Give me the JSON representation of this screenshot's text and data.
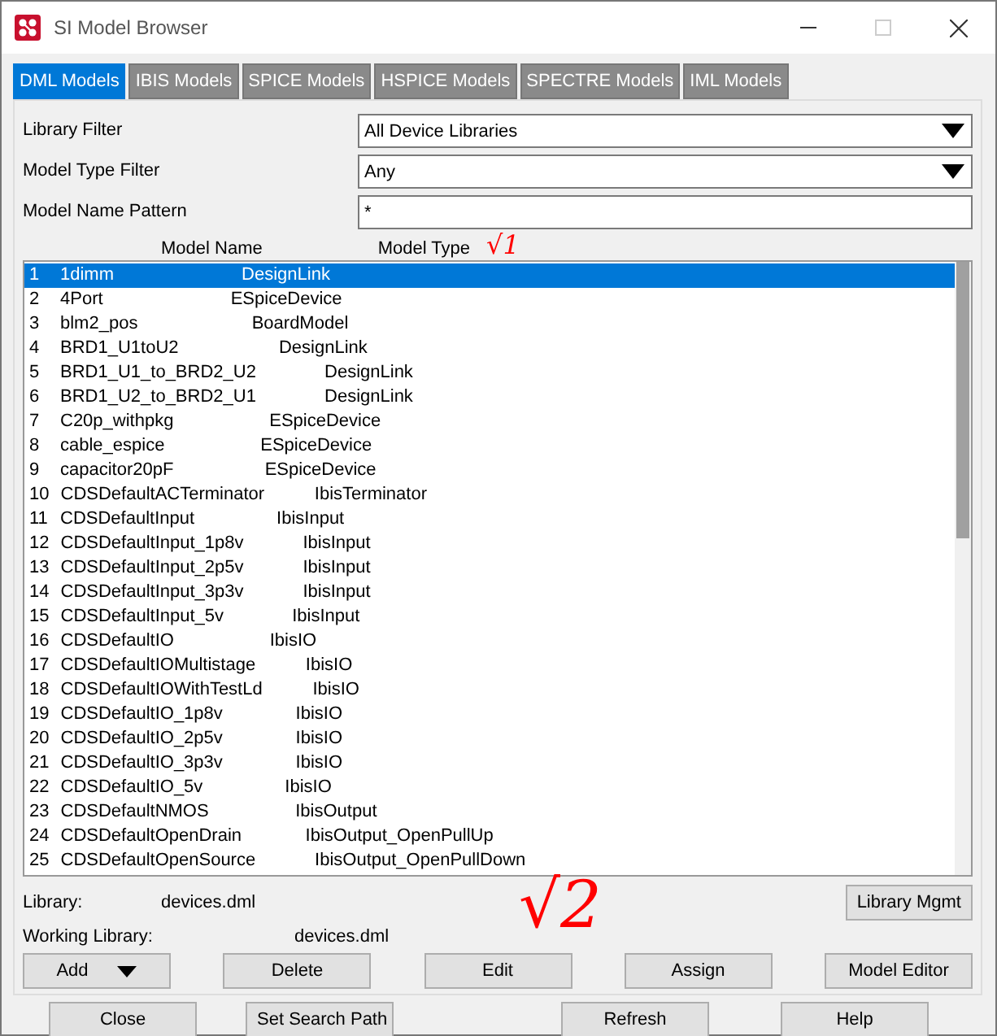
{
  "window": {
    "title": "SI Model Browser"
  },
  "tabs": [
    {
      "label": "DML Models",
      "selected": true
    },
    {
      "label": "IBIS Models",
      "selected": false
    },
    {
      "label": "SPICE Models",
      "selected": false
    },
    {
      "label": "HSPICE Models",
      "selected": false
    },
    {
      "label": "SPECTRE Models",
      "selected": false
    },
    {
      "label": "IML Models",
      "selected": false
    }
  ],
  "filters": [
    {
      "label": "Library Filter",
      "kind": "dropdown",
      "value": "All Device Libraries"
    },
    {
      "label": "Model Type Filter",
      "kind": "dropdown",
      "value": "Any"
    },
    {
      "label": "Model Name Pattern",
      "kind": "text",
      "value": "*"
    }
  ],
  "table": {
    "columns": [
      "Model Name",
      "Model Type"
    ],
    "rows": [
      {
        "number": "1",
        "name": "1dimm",
        "type": "DesignLink",
        "selected": true
      },
      {
        "number": "2",
        "name": "4Port",
        "type": "ESpiceDevice",
        "selected": false
      },
      {
        "number": "3",
        "name": "blm2_pos",
        "type": "BoardModel",
        "selected": false
      },
      {
        "number": "4",
        "name": "BRD1_U1toU2",
        "type": "DesignLink",
        "selected": false
      },
      {
        "number": "5",
        "name": "BRD1_U1_to_BRD2_U2",
        "type": "DesignLink",
        "selected": false
      },
      {
        "number": "6",
        "name": "BRD1_U2_to_BRD2_U1",
        "type": "DesignLink",
        "selected": false
      },
      {
        "number": "7",
        "name": "C20p_withpkg",
        "type": "ESpiceDevice",
        "selected": false
      },
      {
        "number": "8",
        "name": "cable_espice",
        "type": "ESpiceDevice",
        "selected": false
      },
      {
        "number": "9",
        "name": "capacitor20pF",
        "type": "ESpiceDevice",
        "selected": false
      },
      {
        "number": "10",
        "name": "CDSDefaultACTerminator",
        "type": "IbisTerminator",
        "selected": false
      },
      {
        "number": "11",
        "name": "CDSDefaultInput",
        "type": "IbisInput",
        "selected": false
      },
      {
        "number": "12",
        "name": "CDSDefaultInput_1p8v",
        "type": "IbisInput",
        "selected": false
      },
      {
        "number": "13",
        "name": "CDSDefaultInput_2p5v",
        "type": "IbisInput",
        "selected": false
      },
      {
        "number": "14",
        "name": "CDSDefaultInput_3p3v",
        "type": "IbisInput",
        "selected": false
      },
      {
        "number": "15",
        "name": "CDSDefaultInput_5v",
        "type": "IbisInput",
        "selected": false
      },
      {
        "number": "16",
        "name": "CDSDefaultIO",
        "type": "IbisIO",
        "selected": false
      },
      {
        "number": "17",
        "name": "CDSDefaultIOMultistage",
        "type": "IbisIO",
        "selected": false
      },
      {
        "number": "18",
        "name": "CDSDefaultIOWithTestLd",
        "type": "IbisIO",
        "selected": false
      },
      {
        "number": "19",
        "name": "CDSDefaultIO_1p8v",
        "type": "IbisIO",
        "selected": false
      },
      {
        "number": "20",
        "name": "CDSDefaultIO_2p5v",
        "type": "IbisIO",
        "selected": false
      },
      {
        "number": "21",
        "name": "CDSDefaultIO_3p3v",
        "type": "IbisIO",
        "selected": false
      },
      {
        "number": "22",
        "name": "CDSDefaultIO_5v",
        "type": "IbisIO",
        "selected": false
      },
      {
        "number": "23",
        "name": "CDSDefaultNMOS",
        "type": "IbisOutput",
        "selected": false
      },
      {
        "number": "24",
        "name": "CDSDefaultOpenDrain",
        "type": "IbisOutput_OpenPullUp",
        "selected": false
      },
      {
        "number": "25",
        "name": "CDSDefaultOpenSource",
        "type": "IbisOutput_OpenPullDown",
        "selected": false
      }
    ]
  },
  "library": {
    "label": "Library:",
    "value": "devices.dml",
    "button": "Library Mgmt"
  },
  "working_library": {
    "label": "Working Library:",
    "value": "devices.dml"
  },
  "action_buttons": [
    {
      "label": "Add",
      "kind": "menu"
    },
    {
      "label": "Delete",
      "kind": "plain"
    },
    {
      "label": "Edit",
      "kind": "plain"
    },
    {
      "label": "Assign",
      "kind": "plain"
    },
    {
      "label": "Model Editor",
      "kind": "plain"
    }
  ],
  "bottom_buttons": [
    "Close",
    "Set Search Path",
    "Refresh",
    "Help"
  ],
  "annotations": [
    {
      "text": "√1"
    },
    {
      "text": "√2"
    }
  ]
}
